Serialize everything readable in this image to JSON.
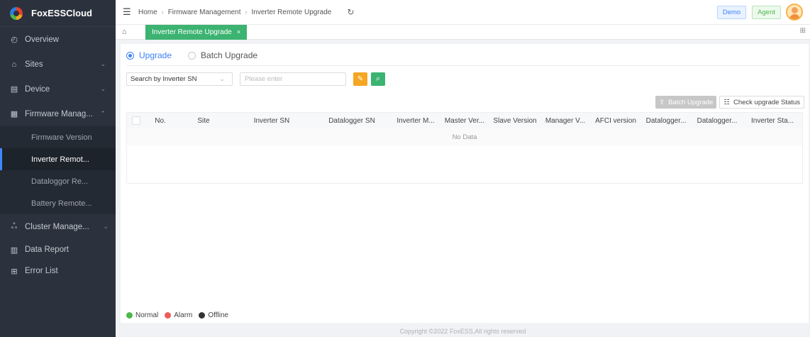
{
  "app": {
    "brand": "FoxESSCloud"
  },
  "sidebar": {
    "items": [
      {
        "label": "Overview",
        "icon": "dashboard-icon"
      },
      {
        "label": "Sites",
        "icon": "home-icon"
      },
      {
        "label": "Device",
        "icon": "device-icon"
      },
      {
        "label": "Firmware Manag...",
        "icon": "firmware-icon"
      },
      {
        "label": "Cluster Manage...",
        "icon": "cluster-icon"
      },
      {
        "label": "Data Report",
        "icon": "chart-icon"
      },
      {
        "label": "Error List",
        "icon": "error-icon"
      }
    ],
    "sub_items": [
      {
        "label": "Firmware Version"
      },
      {
        "label": "Inverter Remot..."
      },
      {
        "label": "Dataloggor Re..."
      },
      {
        "label": "Battery Remote..."
      }
    ]
  },
  "header": {
    "breadcrumb": [
      "Home",
      "Firmware Management",
      "Inverter Remote Upgrade"
    ],
    "demo_label": "Demo",
    "agent_label": "Agent"
  },
  "tabs": {
    "active_label": "Inverter Remote Upgrade",
    "close_glyph": "×"
  },
  "main": {
    "mode_upgrade": "Upgrade",
    "mode_batch": "Batch Upgrade",
    "search_type": "Search by Inverter SN",
    "search_placeholder": "Please enter",
    "batch_upgrade_label": "Batch Upgrade",
    "check_status_label": "Check upgrade Status",
    "columns": [
      "No.",
      "Site",
      "Inverter SN",
      "Datalogger SN",
      "Inverter M...",
      "Master Ver...",
      "Slave Version",
      "Manager V...",
      "AFCI version",
      "Datalogger...",
      "Datalogger...",
      "Inverter Sta..."
    ],
    "no_data": "No Data"
  },
  "legend": [
    {
      "label": "Normal",
      "color": "#4cb84c"
    },
    {
      "label": "Alarm",
      "color": "#f05a5a"
    },
    {
      "label": "Offline",
      "color": "#333333"
    }
  ],
  "footer": {
    "copyright": "Copyright ©2022 FoxESS,All rights reserved"
  },
  "colors": {
    "accent": "#3b82f6",
    "tab_green": "#3cb371",
    "sidebar_bg": "#2b323d"
  }
}
